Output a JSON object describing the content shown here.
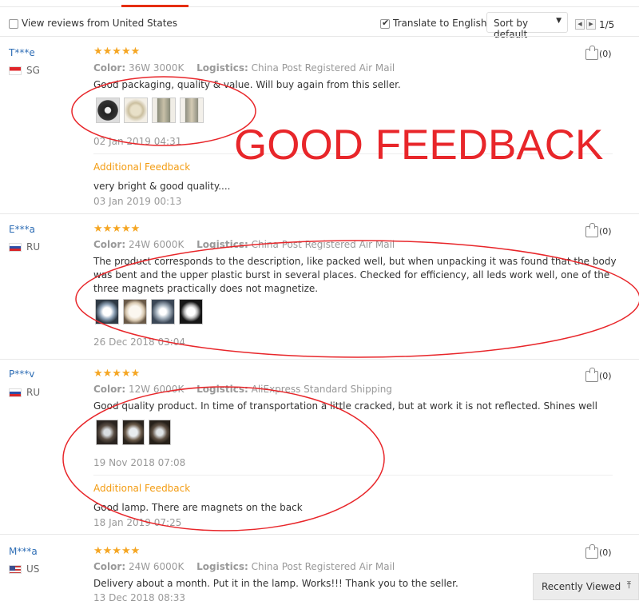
{
  "toolbar": {
    "view_reviews_label": "View reviews from United States",
    "view_reviews_checked": false,
    "translate_label": "Translate to English",
    "translate_checked": true,
    "sort_label": "Sort by default",
    "page_indicator": "1/5"
  },
  "annotation": {
    "headline": "GOOD FEEDBACK",
    "color": "#e8262a"
  },
  "reviews": [
    {
      "name": "T***e",
      "country": "SG",
      "stars": "★★★★★",
      "color_label": "Color:",
      "color_value": "36W 3000K",
      "logistics_label": "Logistics:",
      "logistics_value": "China Post Registered Air Mail",
      "text": "Good packaging, quality & value. Will buy again from this seller.",
      "date": "02 Jan 2019 04:31",
      "likes": "(0)",
      "additional_label": "Additional Feedback",
      "additional_text": "very bright & good quality....",
      "additional_date": "03 Jan 2019 00:13"
    },
    {
      "name": "E***a",
      "country": "RU",
      "stars": "★★★★★",
      "color_label": "Color:",
      "color_value": "24W 6000K",
      "logistics_label": "Logistics:",
      "logistics_value": "China Post Registered Air Mail",
      "text": "The product corresponds to the description, like packed well, but when unpacking it was found that the body was bent and the upper plastic burst in several places. Checked for efficiency, all leds work well, one of the three magnets practically does not magnetize.",
      "date": "26 Dec 2018 03:04",
      "likes": "(0)"
    },
    {
      "name": "P***v",
      "country": "RU",
      "stars": "★★★★★",
      "color_label": "Color:",
      "color_value": "12W 6000K",
      "logistics_label": "Logistics:",
      "logistics_value": "AliExpress Standard Shipping",
      "text": "Good quality product. In time of transportation a little cracked, but at work it is not reflected. Shines well",
      "date": "19 Nov 2018 07:08",
      "likes": "(0)",
      "additional_label": "Additional Feedback",
      "additional_text": "Good lamp. There are magnets on the back",
      "additional_date": "18 Jan 2019 07:25"
    },
    {
      "name": "M***a",
      "country": "US",
      "stars": "★★★★★",
      "color_label": "Color:",
      "color_value": "24W 6000K",
      "logistics_label": "Logistics:",
      "logistics_value": "China Post Registered Air Mail",
      "text": "Delivery about a month. Put it in the lamp. Works!!! Thank you to the seller.",
      "date": "13 Dec 2018 08:33",
      "likes": "(0)"
    }
  ],
  "recently_viewed": {
    "label": "Recently Viewed",
    "icon": "chevron-up-circle-icon"
  }
}
